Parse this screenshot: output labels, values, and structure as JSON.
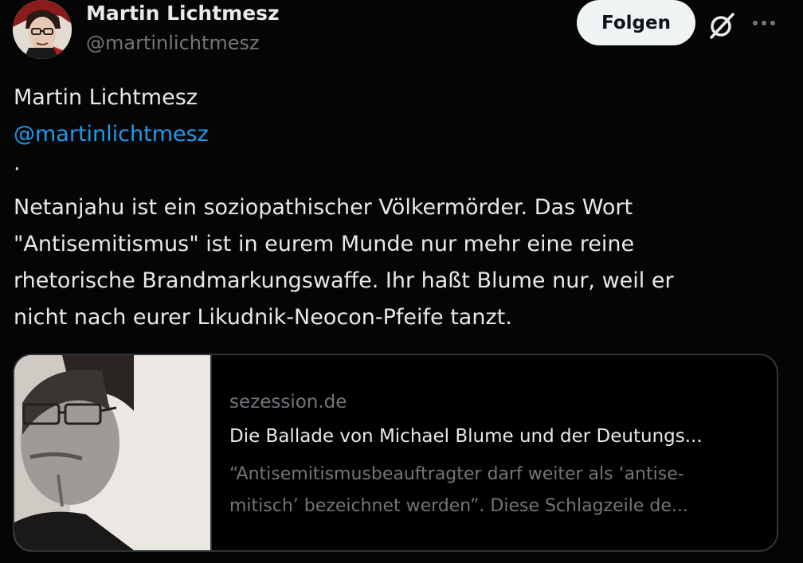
{
  "author": {
    "display_name": "Martin Lichtmesz",
    "handle": "@martinlichtmesz"
  },
  "actions": {
    "follow_label": "Folgen",
    "grok_icon": "grok-icon",
    "more_icon": "more-options-icon"
  },
  "post": {
    "line_name": "Martin Lichtmesz",
    "mention": "@martinlichtmesz",
    "separator": "·",
    "lines": [
      "Netanjahu ist ein soziopathischer Völkermörder. Das Wort",
      "\"Antisemitismus\" ist in eurem Munde nur mehr eine reine",
      "rhetorische Brandmarkungswaffe. Ihr haßt Blume nur, weil er",
      "nicht nach eurer Likudnik-Neocon-Pfeife tanzt."
    ]
  },
  "link_card": {
    "domain": "sezession.de",
    "title": "Die Ballade von Michael Blume und der Deutungs...",
    "description_lines": [
      "“Antisemitismusbeauftragter darf weiter als ‘antise-",
      "mitisch’ bezeichnet werden”. Diese Schlagzeile de..."
    ]
  },
  "colors": {
    "background": "#050505",
    "text": "#e7e9ea",
    "secondary": "#71767b",
    "link": "#1d9bf0",
    "border": "#2f3336",
    "follow_bg": "#eff3f4"
  }
}
